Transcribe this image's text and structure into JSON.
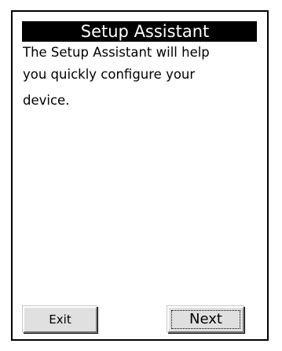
{
  "dialog": {
    "title": "Setup Assistant",
    "message_lines": [
      "The Setup Assistant will help",
      "you quickly configure your",
      "device."
    ]
  },
  "buttons": {
    "exit_label": "Exit",
    "next_label": "Next"
  },
  "colors": {
    "title_bar_background": "#000000",
    "title_text": "#ffffff",
    "button_face": "#e0e0e0"
  }
}
